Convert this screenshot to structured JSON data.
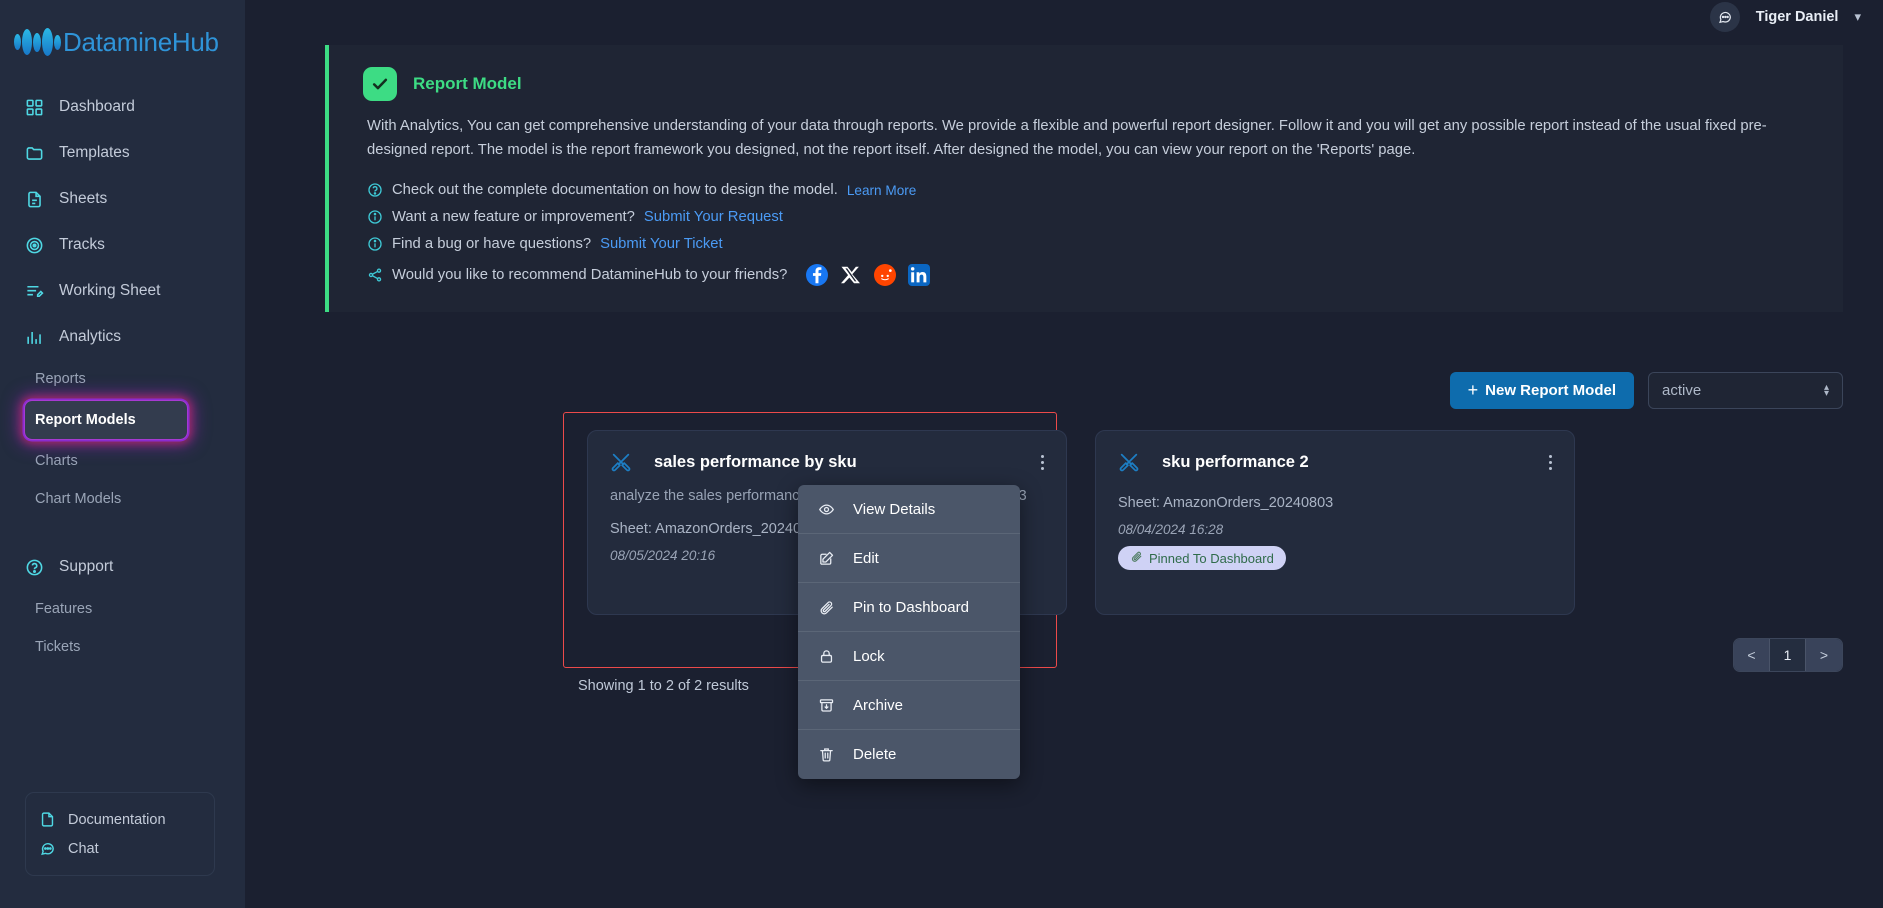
{
  "brand": {
    "name": "DatamineHub"
  },
  "header": {
    "chat_icon": "chat-bubble-icon",
    "username": "Tiger Daniel",
    "caret": "⌄"
  },
  "sidebar": {
    "items": [
      {
        "label": "Dashboard",
        "icon": "grid-icon"
      },
      {
        "label": "Templates",
        "icon": "folder-icon"
      },
      {
        "label": "Sheets",
        "icon": "document-icon"
      },
      {
        "label": "Tracks",
        "icon": "target-icon"
      },
      {
        "label": "Working Sheet",
        "icon": "list-edit-icon"
      },
      {
        "label": "Analytics",
        "icon": "bar-chart-icon"
      }
    ],
    "analytics_children": [
      {
        "label": "Reports",
        "active": false
      },
      {
        "label": "Report Models",
        "active": true
      },
      {
        "label": "Charts",
        "active": false
      },
      {
        "label": "Chart Models",
        "active": false
      }
    ],
    "support": {
      "label": "Support",
      "icon": "question-circle-icon"
    },
    "support_children": [
      {
        "label": "Features"
      },
      {
        "label": "Tickets"
      }
    ],
    "bottom": [
      {
        "label": "Documentation",
        "icon": "file-icon"
      },
      {
        "label": "Chat",
        "icon": "chat-icon"
      }
    ]
  },
  "banner": {
    "title": "Report Model",
    "badge_icon": "check-icon",
    "body": "With Analytics, You can get comprehensive understanding of your data through reports. We provide a flexible and powerful report designer. Follow it and you will get any possible report instead of the usual fixed pre-designed report. The model is the report framework you designed, not the report itself. After designed the model, you can view your report on the 'Reports' page.",
    "lines": [
      {
        "icon": "question-circle-icon",
        "text": "Check out the complete documentation on how to design the model.",
        "link": "Learn More"
      },
      {
        "icon": "info-circle-icon",
        "text": "Want a new feature or improvement?",
        "link": "Submit Your Request"
      },
      {
        "icon": "info-circle-icon",
        "text": "Find a bug or have questions?",
        "link": "Submit Your Ticket"
      }
    ],
    "share": {
      "icon": "share-icon",
      "text": "Would you like to recommend DatamineHub to your friends?",
      "socials": [
        {
          "name": "facebook-icon",
          "color": "#1877F2"
        },
        {
          "name": "x-twitter-icon",
          "color": "#FFFFFF"
        },
        {
          "name": "reddit-icon",
          "color": "#FF4500"
        },
        {
          "name": "linkedin-icon",
          "color": "#0A66C2"
        }
      ]
    }
  },
  "toolbar": {
    "new_button": "New Report Model",
    "plus": "+",
    "status_filter_value": "active"
  },
  "cards": [
    {
      "title": "sales performance by sku",
      "icon": "design-tools-icon",
      "description": "analyze the sales performance by sku AmazonOrders_20240803",
      "sheet": "Sheet: AmazonOrders_20240803",
      "date": "08/05/2024 20:16",
      "pinned": false,
      "pinned_label": ""
    },
    {
      "title": "sku performance 2",
      "icon": "design-tools-icon",
      "description": "",
      "sheet": "Sheet: AmazonOrders_20240803",
      "date": "08/04/2024 16:28",
      "pinned": true,
      "pinned_label": "Pinned To Dashboard"
    }
  ],
  "context_menu": {
    "items": [
      {
        "label": "View Details",
        "icon": "eye-icon"
      },
      {
        "label": "Edit",
        "icon": "pencil-square-icon"
      },
      {
        "label": "Pin to Dashboard",
        "icon": "paperclip-icon"
      },
      {
        "label": "Lock",
        "icon": "lock-icon"
      },
      {
        "label": "Archive",
        "icon": "archive-icon"
      },
      {
        "label": "Delete",
        "icon": "trash-icon"
      }
    ]
  },
  "results": {
    "showing": "Showing 1 to 2 of 2 results"
  },
  "pagination": {
    "prev": "<",
    "current": "1",
    "next": ">"
  },
  "colors": {
    "accent_blue": "#0e6cad",
    "success_green": "#3ddc84",
    "link_blue": "#4b9bf5",
    "sidebar_bg": "#232c3f",
    "main_bg": "#1b2030",
    "card_bg": "#232b3d",
    "menu_bg": "#4b5669",
    "highlight_red": "#ec4a4a",
    "highlight_purple": "#8b2bd0"
  }
}
